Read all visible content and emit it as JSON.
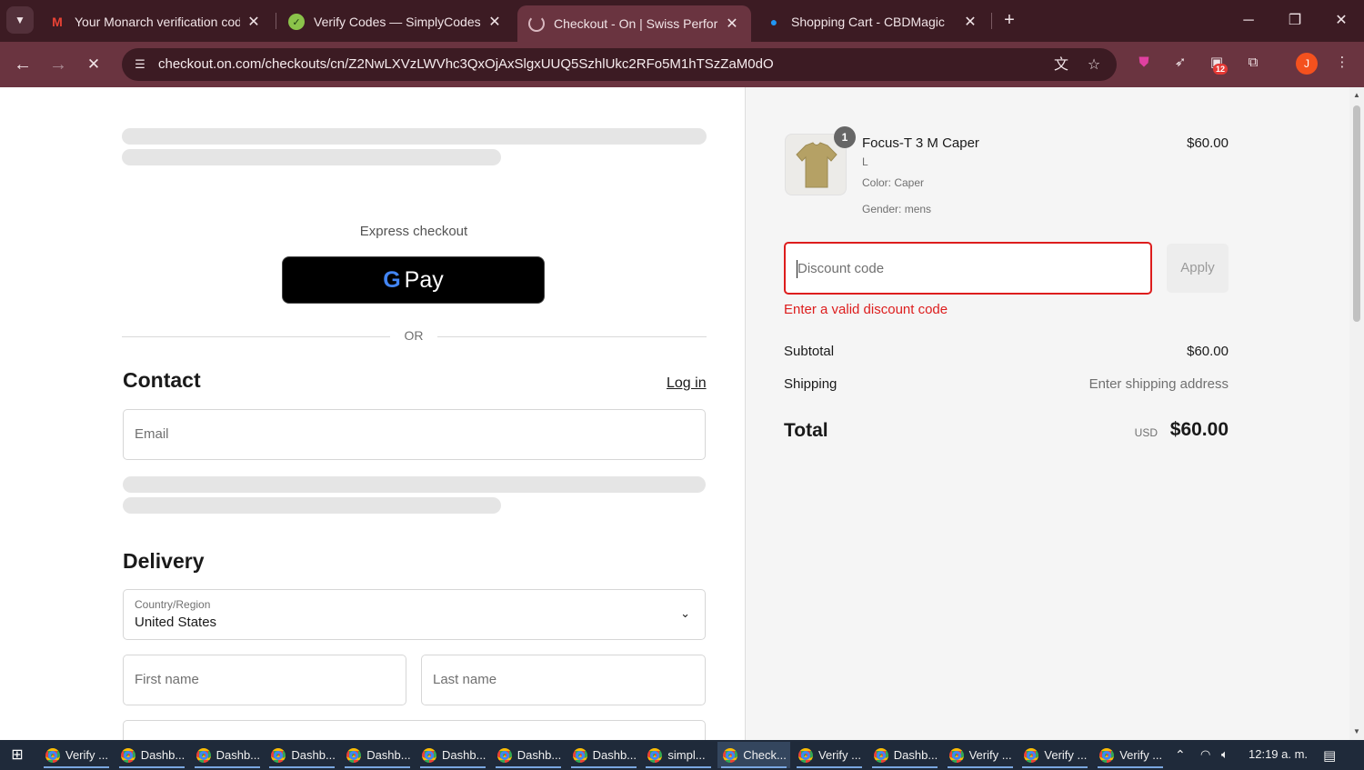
{
  "browser": {
    "tabs": [
      {
        "title": "Your Monarch verification code",
        "icon": "gmail-icon",
        "active": false
      },
      {
        "title": "Verify Codes — SimplyCodes",
        "icon": "simplycodes-icon",
        "active": false
      },
      {
        "title": "Checkout - On | Swiss Performa",
        "icon": "loading-icon",
        "active": true
      },
      {
        "title": "Shopping Cart - CBDMagic",
        "icon": "cbdmagic-icon",
        "active": false
      }
    ],
    "url": "checkout.on.com/checkouts/cn/Z2NwLXVzLWVhc3QxOjAxSlgxUUQ5SzhlUkc2RFo5M1hTSzZaM0dO",
    "extension_badge": "12",
    "profile_initial": "J"
  },
  "checkout": {
    "express_label": "Express checkout",
    "gpay_label": "Pay",
    "gpay_g": "G",
    "or_label": "OR",
    "contact": {
      "title": "Contact",
      "login_label": "Log in",
      "email_placeholder": "Email"
    },
    "delivery": {
      "title": "Delivery",
      "country_label": "Country/Region",
      "country_value": "United States",
      "first_name_placeholder": "First name",
      "last_name_placeholder": "Last name"
    }
  },
  "summary": {
    "item": {
      "quantity": "1",
      "name": "Focus-T 3 M Caper",
      "size": "L",
      "color": "Color: Caper",
      "gender": "Gender: mens",
      "price": "$60.00"
    },
    "discount_placeholder": "Discount code",
    "apply_label": "Apply",
    "discount_error": "Enter a valid discount code",
    "subtotal_label": "Subtotal",
    "subtotal_value": "$60.00",
    "shipping_label": "Shipping",
    "shipping_value": "Enter shipping address",
    "total_label": "Total",
    "total_currency": "USD",
    "total_value": "$60.00"
  },
  "taskbar": {
    "items": [
      {
        "label": "Verify ...",
        "active": false
      },
      {
        "label": "Dashb...",
        "active": false
      },
      {
        "label": "Dashb...",
        "active": false
      },
      {
        "label": "Dashb...",
        "active": false
      },
      {
        "label": "Dashb...",
        "active": false
      },
      {
        "label": "Dashb...",
        "active": false
      },
      {
        "label": "Dashb...",
        "active": false
      },
      {
        "label": "Dashb...",
        "active": false
      },
      {
        "label": "simpl...",
        "active": false
      },
      {
        "label": "Check...",
        "active": true
      },
      {
        "label": "Verify ...",
        "active": false
      },
      {
        "label": "Dashb...",
        "active": false
      },
      {
        "label": "Verify ...",
        "active": false
      },
      {
        "label": "Verify ...",
        "active": false
      },
      {
        "label": "Verify ...",
        "active": false
      }
    ],
    "clock": "12:19 a. m."
  },
  "colors": {
    "browser_frame": "#3c1b23",
    "browser_toolbar": "#6a3440",
    "error_red": "#dd1d1d",
    "taskbar": "#1f2a3a"
  }
}
